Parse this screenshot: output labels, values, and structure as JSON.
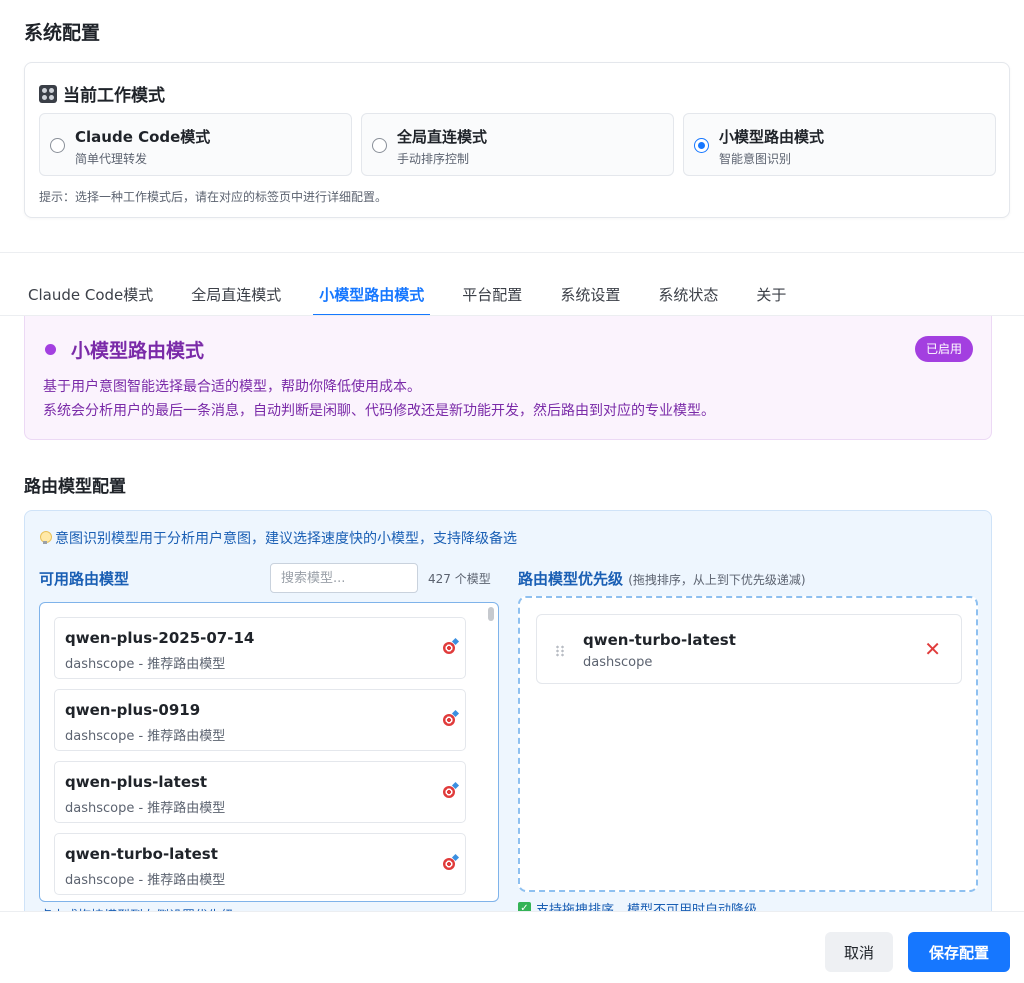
{
  "page": {
    "title": "系统配置"
  },
  "mode_card": {
    "title": "当前工作模式",
    "options": [
      {
        "label": "Claude Code模式",
        "sub": "简单代理转发",
        "selected": false
      },
      {
        "label": "全局直连模式",
        "sub": "手动排序控制",
        "selected": false
      },
      {
        "label": "小模型路由模式",
        "sub": "智能意图识别",
        "selected": true
      }
    ],
    "tip": "提示：选择一种工作模式后，请在对应的标签页中进行详细配置。"
  },
  "tabs": [
    {
      "label": "Claude Code模式",
      "active": false
    },
    {
      "label": "全局直连模式",
      "active": false
    },
    {
      "label": "小模型路由模式",
      "active": true
    },
    {
      "label": "平台配置",
      "active": false
    },
    {
      "label": "系统设置",
      "active": false
    },
    {
      "label": "系统状态",
      "active": false
    },
    {
      "label": "关于",
      "active": false
    }
  ],
  "banner": {
    "title": "小模型路由模式",
    "badge": "已启用",
    "line1": "基于用户意图智能选择最合适的模型，帮助你降低使用成本。",
    "line2": "系统会分析用户的最后一条消息，自动判断是闲聊、代码修改还是新功能开发，然后路由到对应的专业模型。"
  },
  "routing": {
    "section_title": "路由模型配置",
    "tip": "意图识别模型用于分析用户意图，建议选择速度快的小模型，支持降级备选",
    "available_title": "可用路由模型",
    "search_placeholder": "搜索模型...",
    "count": "427 个模型",
    "models": [
      {
        "name": "qwen-plus-2025-07-14",
        "sub": "dashscope - 推荐路由模型"
      },
      {
        "name": "qwen-plus-0919",
        "sub": "dashscope - 推荐路由模型"
      },
      {
        "name": "qwen-plus-latest",
        "sub": "dashscope - 推荐路由模型"
      },
      {
        "name": "qwen-turbo-latest",
        "sub": "dashscope - 推荐路由模型"
      }
    ],
    "priority_title": "路由模型优先级",
    "priority_hint": "(拖拽排序，从上到下优先级递减)",
    "priority_items": [
      {
        "name": "qwen-turbo-latest",
        "sub": "dashscope"
      }
    ],
    "left_note": "点击或拖拽模型到右侧设置优先级",
    "right_note": "支持拖拽排序，模型不可用时自动降级"
  },
  "footer": {
    "cancel": "取消",
    "save": "保存配置"
  },
  "colors": {
    "accent": "#1677ff",
    "purple": "#a33fe0",
    "danger": "#e03b3b"
  }
}
